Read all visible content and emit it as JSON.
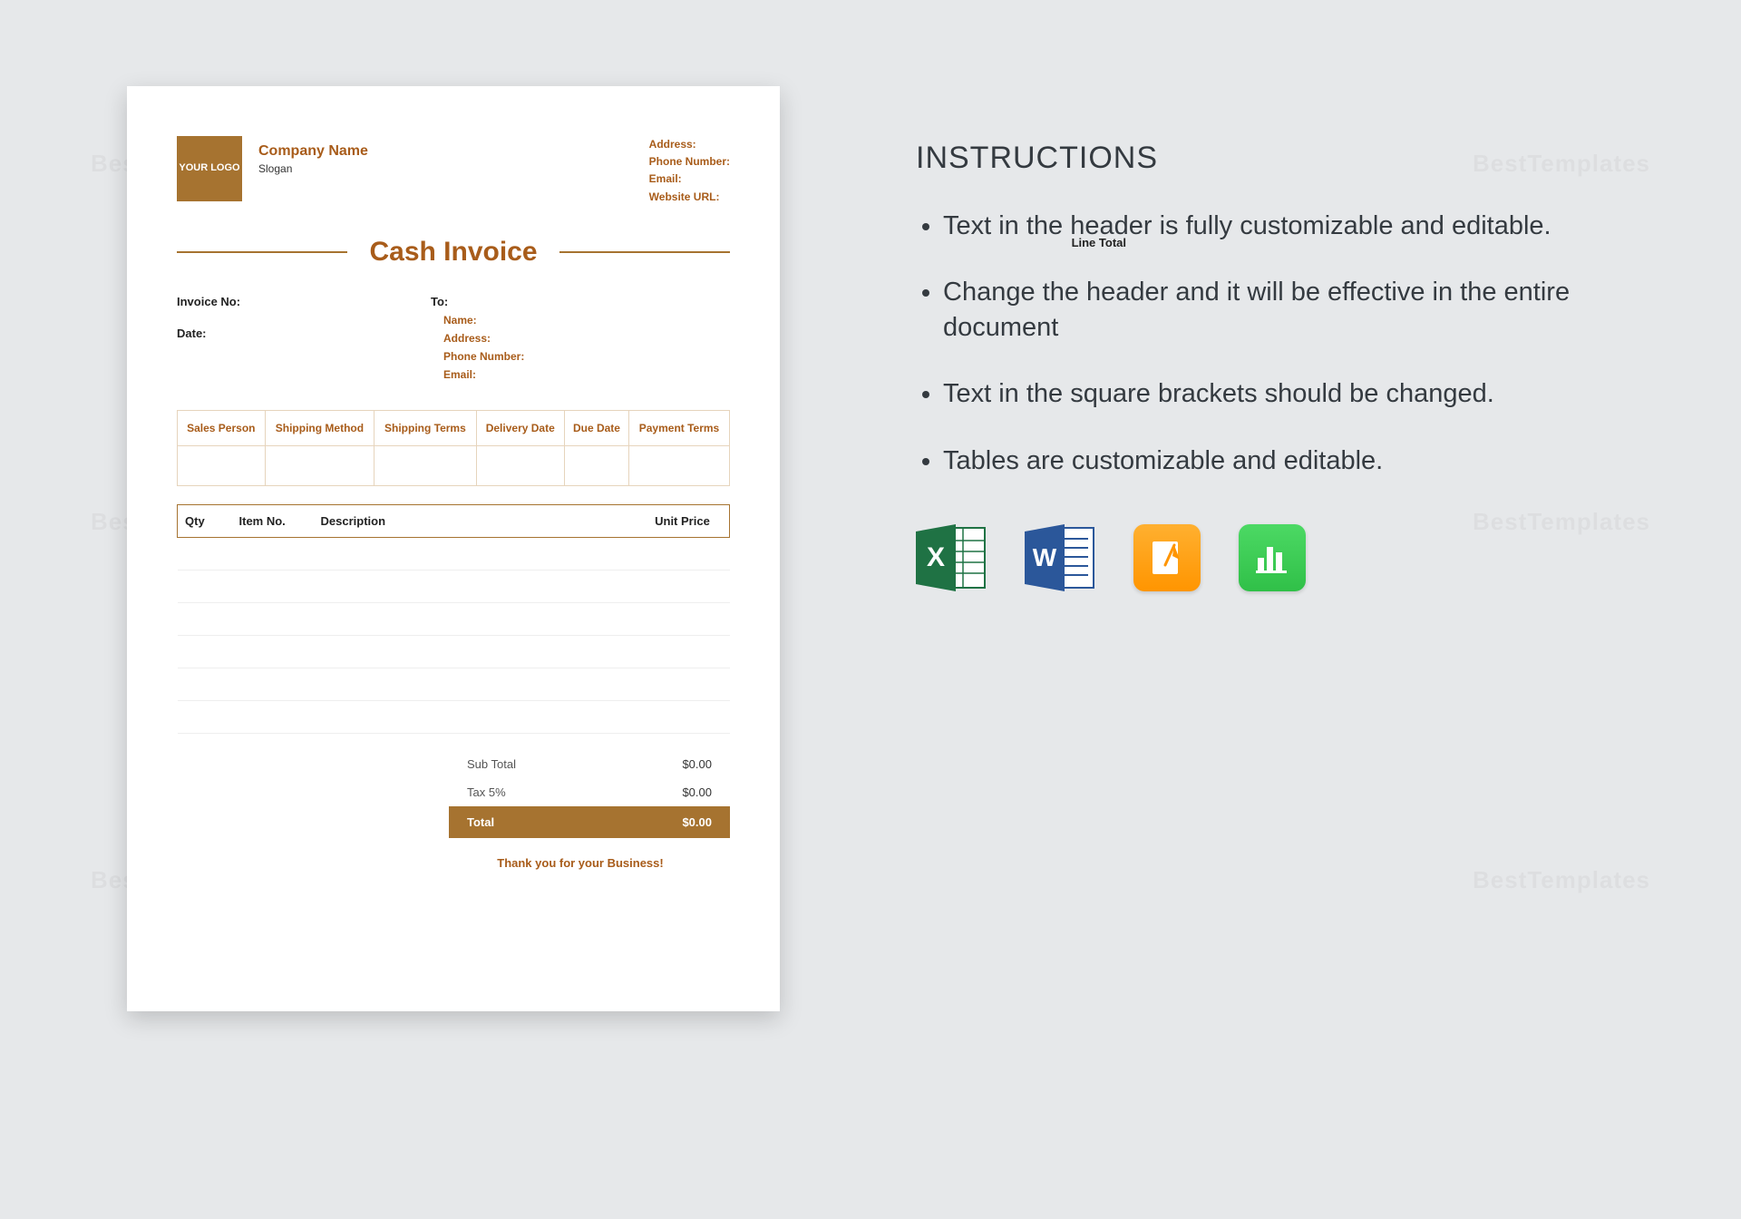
{
  "watermark": "BestTemplates",
  "document": {
    "logo_text": "YOUR LOGO",
    "company_name": "Company Name",
    "slogan": "Slogan",
    "contact": {
      "address": "Address:",
      "phone": "Phone Number:",
      "email": "Email:",
      "website": "Website URL:"
    },
    "title": "Cash Invoice",
    "meta": {
      "invoice_no": "Invoice No:",
      "date": "Date:",
      "to": "To:",
      "name": "Name:",
      "address": "Address:",
      "phone": "Phone Number:",
      "email": "Email:"
    },
    "info_headers": [
      "Sales Person",
      "Shipping Method",
      "Shipping Terms",
      "Delivery Date",
      "Due Date",
      "Payment Terms"
    ],
    "item_headers": {
      "qty": "Qty",
      "item_no": "Item No.",
      "description": "Description",
      "unit_price": "Unit Price",
      "line_total": "Line Total"
    },
    "totals": {
      "subtotal_label": "Sub Total",
      "subtotal_value": "$0.00",
      "tax_label": "Tax 5%",
      "tax_value": "$0.00",
      "total_label": "Total",
      "total_value": "$0.00"
    },
    "thanks": "Thank you for your Business!"
  },
  "instructions": {
    "title": "INSTRUCTIONS",
    "bullets": [
      "Text in the header is fully customizable and editable.",
      "Change the header and it will be effective in the entire document",
      "Text in the square brackets should be changed.",
      "Tables are customizable and editable."
    ]
  },
  "icons": {
    "excel": "excel-icon",
    "word": "word-icon",
    "pages": "pages-icon",
    "numbers": "numbers-icon"
  }
}
